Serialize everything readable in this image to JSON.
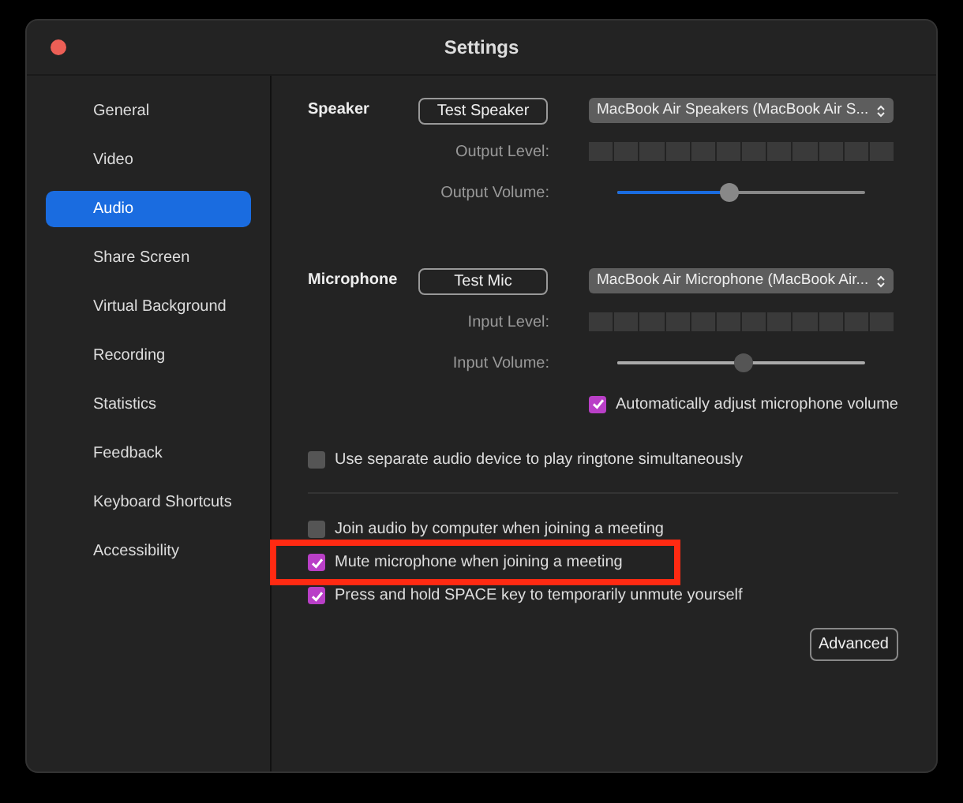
{
  "window": {
    "title": "Settings"
  },
  "sidebar": {
    "items": [
      {
        "label": "General",
        "selected": false
      },
      {
        "label": "Video",
        "selected": false
      },
      {
        "label": "Audio",
        "selected": true
      },
      {
        "label": "Share Screen",
        "selected": false
      },
      {
        "label": "Virtual Background",
        "selected": false
      },
      {
        "label": "Recording",
        "selected": false
      },
      {
        "label": "Statistics",
        "selected": false
      },
      {
        "label": "Feedback",
        "selected": false
      },
      {
        "label": "Keyboard Shortcuts",
        "selected": false
      },
      {
        "label": "Accessibility",
        "selected": false
      }
    ]
  },
  "sections": [
    {
      "heading": "Speaker",
      "test_button": "Test Speaker",
      "device": "MacBook Air Speakers (MacBook Air S...",
      "level_label": "Output Level:",
      "volume_label": "Output Volume:",
      "volume": {
        "level": 0.45,
        "disabled": false
      }
    },
    {
      "heading": "Microphone",
      "test_button": "Test Mic",
      "device": "MacBook Air Microphone (MacBook Air...",
      "level_label": "Input Level:",
      "volume_label": "Input Volume:",
      "volume": {
        "level": 0.51,
        "disabled": true
      }
    }
  ],
  "auto_adjust": {
    "label": "Automatically adjust microphone volume",
    "checked": true
  },
  "separate_device": {
    "label": "Use separate audio device to play ringtone simultaneously",
    "checked": false
  },
  "options": [
    {
      "label": "Join audio by computer when joining a meeting",
      "checked": false,
      "highlighted": false
    },
    {
      "label": "Mute microphone when joining a meeting",
      "checked": true,
      "highlighted": true
    },
    {
      "label": "Press and hold SPACE key to temporarily unmute yourself",
      "checked": true,
      "highlighted": false
    }
  ],
  "advanced_button": "Advanced"
}
